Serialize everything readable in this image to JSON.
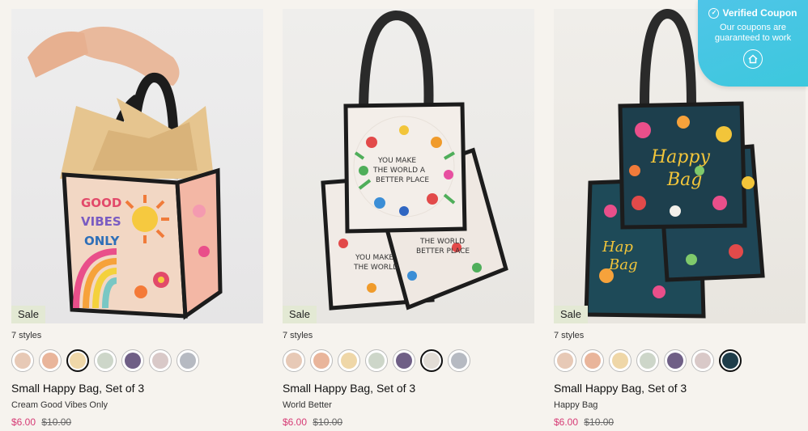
{
  "products": [
    {
      "badge": "Sale",
      "styles_label": "7 styles",
      "title": "Small Happy Bag, Set of 3",
      "variant": "Cream Good Vibes Only",
      "price_now": "$6.00",
      "price_was": "$10.00",
      "bag_text": "GOOD VIBES ONLY",
      "selected_swatch": 2,
      "swatch_colors": [
        "#e7c9b6",
        "#e9b59b",
        "#efd7a8",
        "#cdd6c9",
        "#6f5f86",
        "#d9c9c8",
        "#b6bac2"
      ]
    },
    {
      "badge": "Sale",
      "styles_label": "7 styles",
      "title": "Small Happy Bag, Set of 3",
      "variant": "World Better",
      "price_now": "$6.00",
      "price_was": "$10.00",
      "bag_text": "YOU MAKE THE WORLD A BETTER PLACE",
      "selected_swatch": 5,
      "swatch_colors": [
        "#e7c9b6",
        "#e9b59b",
        "#efd7a8",
        "#cdd6c9",
        "#6f5f86",
        "#e2ddd6",
        "#b6bac2"
      ]
    },
    {
      "badge": "Sale",
      "styles_label": "7 styles",
      "title": "Small Happy Bag, Set of 3",
      "variant": "Happy Bag",
      "price_now": "$6.00",
      "price_was": "$10.00",
      "bag_text": "Happy Bag",
      "selected_swatch": 6,
      "swatch_colors": [
        "#e7c9b6",
        "#e9b59b",
        "#efd7a8",
        "#cdd6c9",
        "#6f5f86",
        "#d9c9c8",
        "#1f3d4a"
      ]
    }
  ],
  "coupon": {
    "title": "Verified Coupon",
    "subtitle": "Our coupons are guaranteed to work",
    "check_icon": "check-circle-icon",
    "home_icon": "home-icon"
  },
  "colors": {
    "sale_price": "#d63b75",
    "sale_badge_bg": "#e3e9d4",
    "coupon_bg": "#45c6e2"
  }
}
